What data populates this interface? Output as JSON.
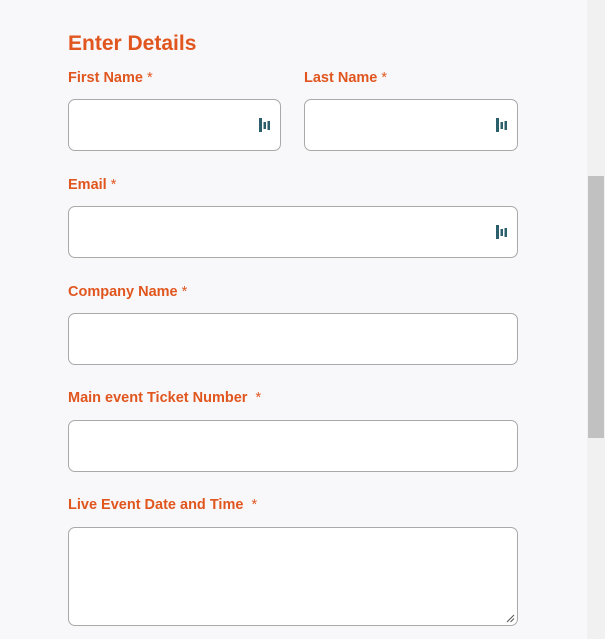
{
  "form": {
    "heading": "Enter Details",
    "required_marker": "*",
    "fields": [
      {
        "key": "first_name",
        "label": "First Name",
        "value": ""
      },
      {
        "key": "last_name",
        "label": "Last Name",
        "value": ""
      },
      {
        "key": "email",
        "label": "Email",
        "value": ""
      },
      {
        "key": "company_name",
        "label": "Company Name",
        "value": ""
      },
      {
        "key": "ticket_number",
        "label": "Main event Ticket Number",
        "value": ""
      },
      {
        "key": "event_datetime",
        "label": "Live Event Date and Time",
        "value": ""
      }
    ]
  },
  "colors": {
    "accent": "#e0561e",
    "autofill_icon": "#2b5f6b",
    "field_border": "#a9a9a9",
    "scrollbar_thumb": "#c1c1c1"
  },
  "icons": {
    "autofill": "password-manager-autofill-icon",
    "resize": "textarea-resize-icon"
  }
}
